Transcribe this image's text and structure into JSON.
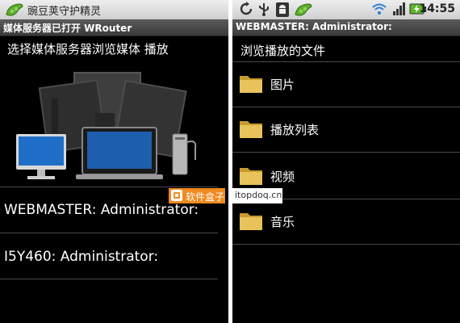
{
  "left": {
    "status_bar": {
      "notification_text": "豌豆荚守护精灵"
    },
    "title_bar": {
      "title": "媒体服务器已打开 WRouter"
    },
    "prompt": "选择媒体服务器浏览媒体 播放",
    "servers": [
      {
        "label": "WEBMASTER: Administrator:"
      },
      {
        "label": "I5Y460: Administrator:"
      }
    ]
  },
  "right": {
    "status_bar": {
      "time": "14:55",
      "icons": [
        "sync-icon",
        "usb-icon",
        "android-icon",
        "pea-icon",
        "wifi-icon",
        "signal-icon",
        "battery-charging-icon"
      ]
    },
    "title_bar": {
      "title": "WEBMASTER: Administrator:"
    },
    "header": "浏览播放的文件",
    "folders": [
      {
        "label": "图片",
        "icon": "folder-icon"
      },
      {
        "label": "播放列表",
        "icon": "folder-icon"
      },
      {
        "label": "视频",
        "icon": "folder-icon"
      },
      {
        "label": "音乐",
        "icon": "folder-icon"
      }
    ]
  },
  "watermark": {
    "brand": "软件盒子",
    "url": "itopdoq.cn"
  },
  "colors": {
    "folder": "#e8c25a",
    "background": "#000000",
    "watermark_orange": "#f08a1e"
  }
}
